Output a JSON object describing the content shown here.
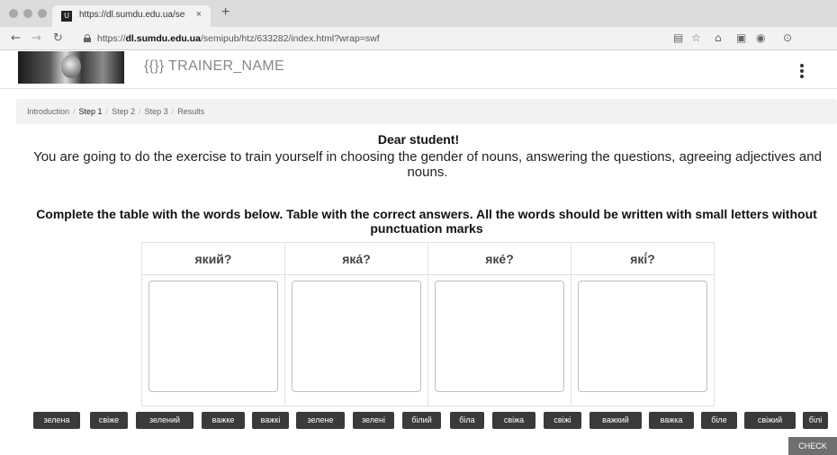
{
  "browser": {
    "tab_title": "https://dl.sumdu.edu.ua/semip",
    "tab_favicon": "U",
    "tab_close": "×",
    "new_tab": "+",
    "url_host_prefix": "https://",
    "url_host": "dl.sumdu.edu.ua",
    "url_path": "/semipub/htz/633282/index.html?wrap=swf"
  },
  "app": {
    "trainer_name": "{{}} TRAINER_NAME"
  },
  "breadcrumb": [
    {
      "label": "Introduction",
      "active": false
    },
    {
      "label": "Step 1",
      "active": true
    },
    {
      "label": "Step 2",
      "active": false
    },
    {
      "label": "Step 3",
      "active": false
    },
    {
      "label": "Results",
      "active": false
    }
  ],
  "content": {
    "heading": "Dear student!",
    "intro": "You are going to do the exercise to train yourself in choosing the gender of nouns, answering the questions, agreeing adjectives and nouns.",
    "task": "Complete the table with the words below. Table with the correct answers. All the words should be written with small letters without punctuation marks"
  },
  "table": {
    "columns": [
      "який?",
      "яка́?",
      "яке́?",
      "які́?"
    ]
  },
  "words": [
    "зелена",
    "свіже",
    "зелений",
    "важке",
    "важкі",
    "зелене",
    "зелені",
    "білий",
    "біла",
    "свіжа",
    "свіжі",
    "важкий",
    "важка",
    "біле",
    "свіжий",
    "білі"
  ],
  "check_label": "CHECK"
}
